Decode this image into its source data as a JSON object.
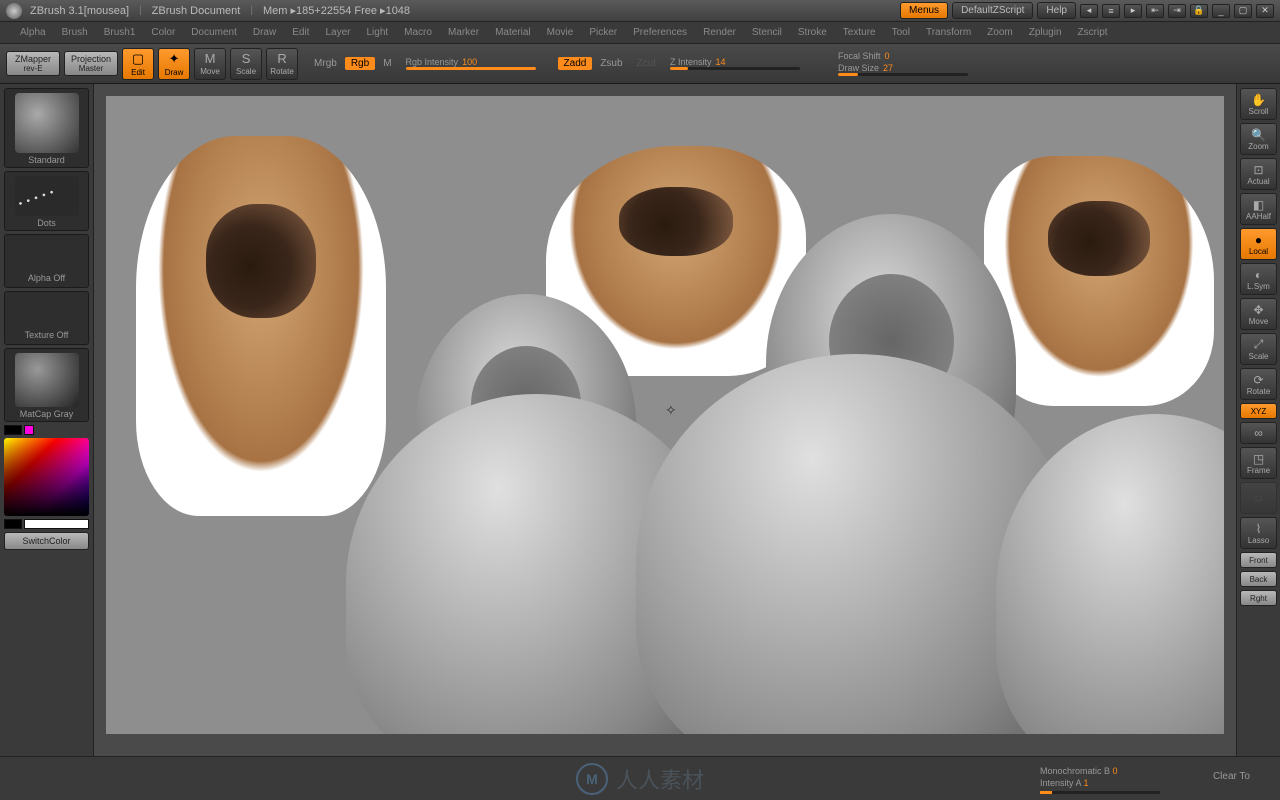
{
  "titlebar": {
    "app": "ZBrush 3.1[mousea]",
    "doc": "ZBrush Document",
    "mem": "Mem ▸185+22554 Free ▸1048",
    "menus_btn": "Menus",
    "default_zscript": "DefaultZScript",
    "help": "Help"
  },
  "menus": [
    "Alpha",
    "Brush",
    "Brush1",
    "Color",
    "Document",
    "Draw",
    "Edit",
    "Layer",
    "Light",
    "Macro",
    "Marker",
    "Material",
    "Movie",
    "Picker",
    "Preferences",
    "Render",
    "Stencil",
    "Stroke",
    "Texture",
    "Tool",
    "Transform",
    "Zoom",
    "Zplugin",
    "Zscript"
  ],
  "toolbar": {
    "zmapper": {
      "l1": "ZMapper",
      "l2": "rev-E"
    },
    "projmaster": {
      "l1": "Projection",
      "l2": "Master"
    },
    "edit": "Edit",
    "draw": "Draw",
    "move": "Move",
    "scale": "Scale",
    "rotate": "Rotate",
    "mrgb": "Mrgb",
    "rgb": "Rgb",
    "m": "M",
    "rgb_intensity": {
      "label": "Rgb Intensity",
      "value": "100"
    },
    "zadd": "Zadd",
    "zsub": "Zsub",
    "zcut": "Zcut",
    "z_intensity": {
      "label": "Z Intensity",
      "value": "14"
    },
    "focal_shift": {
      "label": "Focal Shift",
      "value": "0"
    },
    "draw_size": {
      "label": "Draw Size",
      "value": "27"
    }
  },
  "left": {
    "brush": "Standard",
    "stroke": "Dots",
    "alpha": "Alpha Off",
    "texture": "Texture Off",
    "material": "MatCap Gray",
    "switch": "SwitchColor"
  },
  "right": {
    "scroll": "Scroll",
    "zoom": "Zoom",
    "actual": "Actual",
    "aahalf": "AAHalf",
    "local": "Local",
    "lsym": "L.Sym",
    "move": "Move",
    "scale": "Scale",
    "rotate": "Rotate",
    "xyz": "XYZ",
    "frame": "Frame",
    "lasso": "Lasso",
    "front": "Front",
    "back": "Back",
    "right_v": "Rght"
  },
  "footer": {
    "watermark": "人人素材",
    "mono": {
      "label": "Monochromatic B",
      "value": "0"
    },
    "inta": {
      "label": "Intensity A",
      "value": "1"
    },
    "clear": "Clear To"
  }
}
